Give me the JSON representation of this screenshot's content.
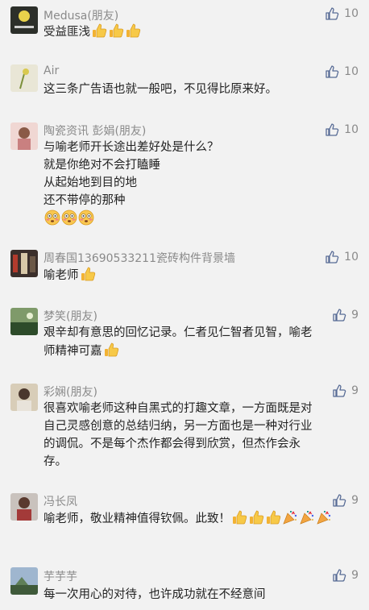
{
  "comments": [
    {
      "name": "Medusa(朋友)",
      "likes": "10",
      "lines": [
        "受益匪浅"
      ],
      "emoji": [
        "thumbs-up",
        "thumbs-up",
        "thumbs-up"
      ]
    },
    {
      "name": "Air",
      "likes": "10",
      "lines": [
        "这三条广告语也就一般吧，不见得比原来好。"
      ],
      "emoji": []
    },
    {
      "name": "陶瓷资讯 彭娟(朋友)",
      "likes": "10",
      "lines": [
        "与喻老师开长途出差好处是什么？",
        "就是你绝对不会打瞌睡",
        "从起始地到目的地",
        "还不带停的那种"
      ],
      "emoji": [
        "flushed",
        "flushed",
        "flushed"
      ]
    },
    {
      "name": "周春国13690533211瓷砖构件背景墙",
      "likes": "10",
      "lines": [
        "喻老师"
      ],
      "emoji": [
        "thumbs-up"
      ]
    },
    {
      "name": "梦笑(朋友)",
      "likes": "9",
      "lines": [
        "艰辛却有意思的回忆记录。仁者见仁智者见智，喻老",
        "师精神可嘉"
      ],
      "emoji": [
        "thumbs-up"
      ]
    },
    {
      "name": "彩娴(朋友)",
      "likes": "9",
      "lines": [
        "很喜欢喻老师这种自黑式的打趣文章，一方面既是对",
        "自己灵感创意的总结归纳，另一方面也是一种对行业",
        "的调侃。不是每个杰作都会得到欣赏，但杰作会永",
        "存。"
      ],
      "emoji": []
    },
    {
      "name": "冯长凤",
      "likes": "9",
      "lines": [
        "喻老师，敬业精神值得钦佩。此致！"
      ],
      "emoji": [
        "thumbs-up",
        "thumbs-up",
        "thumbs-up",
        "party",
        "party",
        "party"
      ]
    },
    {
      "name": "芋芋芋",
      "likes": "9",
      "lines": [
        "每一次用心的对待，也许成功就在不经意间"
      ],
      "emoji": []
    }
  ]
}
